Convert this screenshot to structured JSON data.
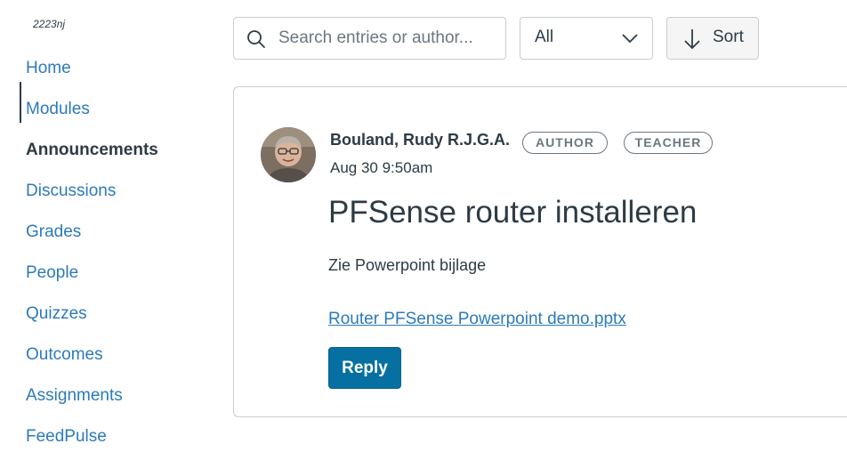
{
  "course": {
    "code": "2223nj"
  },
  "sidebar": {
    "items": [
      {
        "label": "Home",
        "active": false
      },
      {
        "label": "Modules",
        "active": false
      },
      {
        "label": "Announcements",
        "active": true
      },
      {
        "label": "Discussions",
        "active": false
      },
      {
        "label": "Grades",
        "active": false
      },
      {
        "label": "People",
        "active": false
      },
      {
        "label": "Quizzes",
        "active": false
      },
      {
        "label": "Outcomes",
        "active": false
      },
      {
        "label": "Assignments",
        "active": false
      },
      {
        "label": "FeedPulse",
        "active": false
      }
    ]
  },
  "toolbar": {
    "search_placeholder": "Search entries or author...",
    "filter_value": "All",
    "sort_label": "Sort",
    "icons": {
      "search": "search-icon",
      "filter": "chevron-down-icon",
      "sort": "arrow-down-icon"
    }
  },
  "entry": {
    "author": "Bouland, Rudy R.J.G.A.",
    "badges": [
      "AUTHOR",
      "TEACHER"
    ],
    "timestamp": "Aug 30 9:50am",
    "title": "PFSense router installeren",
    "body": "Zie Powerpoint bijlage",
    "attachment": "Router PFSense Powerpoint demo.pptx",
    "reply_label": "Reply"
  },
  "colors": {
    "link": "#2b7abc",
    "text": "#2d3b45",
    "primary_button": "#0770a3",
    "border": "#c7cdd1"
  }
}
